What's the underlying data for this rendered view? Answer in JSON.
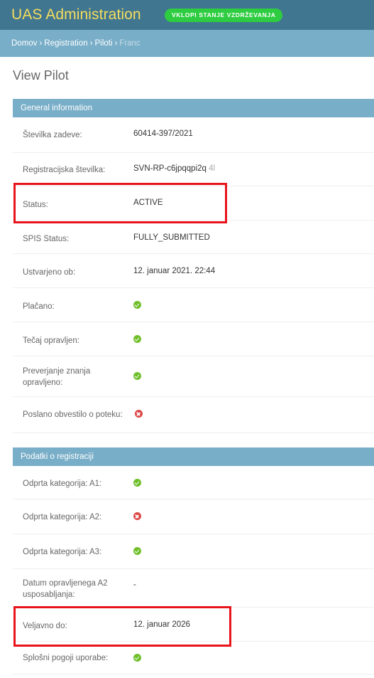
{
  "header": {
    "brand": "UAS Administration",
    "maintenance_button": "VKLOPI STANJE VZDRŽEVANJA"
  },
  "breadcrumbs": {
    "home": "Domov",
    "app": "Registration",
    "model": "Piloti",
    "current": "Franc"
  },
  "page_title": "View Pilot",
  "general": {
    "heading": "General information",
    "rows": {
      "case_number": {
        "label": "Številka zadeve:",
        "value": "60414-397/2021"
      },
      "registration_number": {
        "label": "Registracijska številka:",
        "value": "SVN-RP-c6jpqqpi2q",
        "value_suffix": "4l"
      },
      "status": {
        "label": "Status:",
        "value": "ACTIVE"
      },
      "spis_status": {
        "label": "SPIS Status:",
        "value": "FULLY_SUBMITTED"
      },
      "created_at": {
        "label": "Ustvarjeno ob:",
        "value": "12. januar 2021. 22:44"
      },
      "paid": {
        "label": "Plačano:",
        "icon": "check-circle-icon"
      },
      "course_completed": {
        "label": "Tečaj opravljen:",
        "icon": "check-circle-icon"
      },
      "knowledge_check": {
        "label": "Preverjanje znanja opravljeno:",
        "icon": "check-circle-icon"
      },
      "expiry_notice_sent": {
        "label": "Poslano obvestilo o poteku:",
        "icon": "cross-circle-icon"
      }
    }
  },
  "registration": {
    "heading": "Podatki o registraciji",
    "rows": {
      "open_a1": {
        "label": "Odprta kategorija: A1:",
        "icon": "check-circle-icon"
      },
      "open_a2": {
        "label": "Odprta kategorija: A2:",
        "icon": "cross-circle-icon"
      },
      "open_a3": {
        "label": "Odprta kategorija: A3:",
        "icon": "check-circle-icon"
      },
      "a2_training_date": {
        "label": "Datum opravljenega A2 usposabljanja:",
        "value": "-"
      },
      "valid_until": {
        "label": "Veljavno do:",
        "value": "12. januar 2026"
      },
      "terms": {
        "label": "Splošni pogoji uporabe:",
        "icon": "check-circle-icon"
      }
    }
  },
  "colors": {
    "header_bg": "#417690",
    "brand_text": "#f5dd5d",
    "breadcrumb_bg": "#79aec8",
    "module_header_bg": "#79aec8",
    "button_green": "#2ecc40",
    "yes_icon": "#70bf2b",
    "no_icon": "#dd4646",
    "highlight_red": "#e8141c"
  }
}
